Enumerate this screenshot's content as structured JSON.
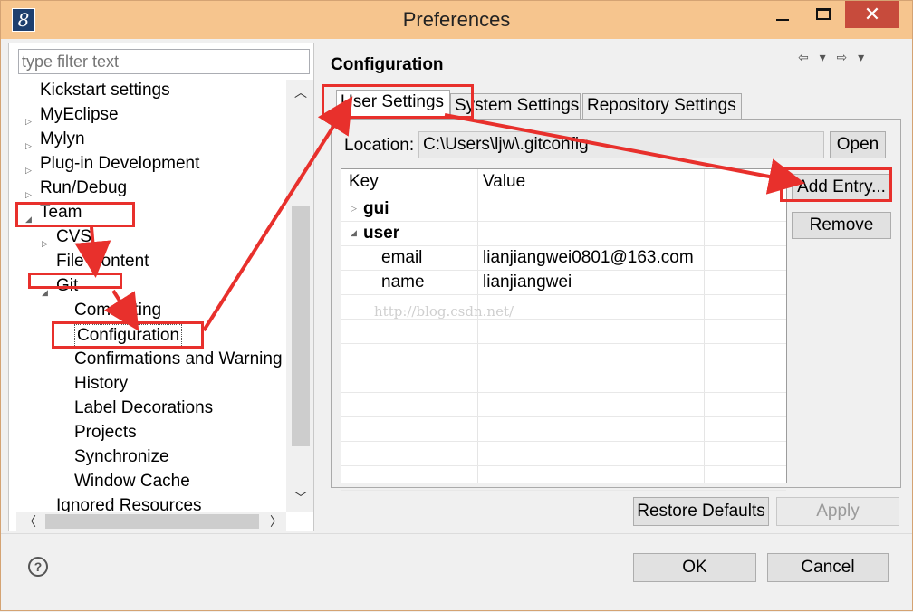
{
  "window": {
    "title": "Preferences",
    "app_icon_glyph": "8",
    "minimize_glyph": "",
    "close_glyph": "✕"
  },
  "left": {
    "filter_placeholder": "type filter text",
    "tree": [
      {
        "label": "Kickstart settings",
        "twisty": "",
        "level": 0
      },
      {
        "label": "MyEclipse",
        "twisty": "▷",
        "level": 0
      },
      {
        "label": "Mylyn",
        "twisty": "▷",
        "level": 0
      },
      {
        "label": "Plug-in Development",
        "twisty": "▷",
        "level": 0
      },
      {
        "label": "Run/Debug",
        "twisty": "▷",
        "level": 0
      },
      {
        "label": "Team",
        "twisty": "◢",
        "level": 0
      },
      {
        "label": "CVS",
        "twisty": "▷",
        "level": 1
      },
      {
        "label": "File Content",
        "twisty": "",
        "level": 1
      },
      {
        "label": "Git",
        "twisty": "◢",
        "level": 1
      },
      {
        "label": "Committing",
        "twisty": "",
        "level": 2
      },
      {
        "label": "Configuration",
        "twisty": "",
        "level": 2
      },
      {
        "label": "Confirmations and Warning",
        "twisty": "",
        "level": 2
      },
      {
        "label": "History",
        "twisty": "",
        "level": 2
      },
      {
        "label": "Label Decorations",
        "twisty": "",
        "level": 2
      },
      {
        "label": "Projects",
        "twisty": "",
        "level": 2
      },
      {
        "label": "Synchronize",
        "twisty": "",
        "level": 2
      },
      {
        "label": "Window Cache",
        "twisty": "",
        "level": 2
      },
      {
        "label": "Ignored Resources",
        "twisty": "",
        "level": 1
      }
    ]
  },
  "right": {
    "title": "Configuration",
    "nav_glyphs": "⇦ ▾ ⇨ ▾",
    "tabs": [
      "User Settings",
      "System Settings",
      "Repository Settings"
    ],
    "location_label": "Location:",
    "location_value": "C:\\Users\\ljw\\.gitconfig",
    "open_button": "Open",
    "columns": [
      "Key",
      "Value"
    ],
    "rows": [
      {
        "key": "gui",
        "value": "",
        "twisty": "▷",
        "bold": true
      },
      {
        "key": "user",
        "value": "",
        "twisty": "◢",
        "bold": true
      },
      {
        "key": "email",
        "value": "lianjiangwei0801@163.com",
        "twisty": "",
        "bold": false
      },
      {
        "key": "name",
        "value": "lianjiangwei",
        "twisty": "",
        "bold": false
      }
    ],
    "add_entry_button": "Add Entry...",
    "remove_button": "Remove",
    "watermark": "http://blog.csdn.net/",
    "restore_defaults_button": "Restore Defaults",
    "apply_button": "Apply"
  },
  "footer": {
    "help_glyph": "?",
    "ok_button": "OK",
    "cancel_button": "Cancel"
  },
  "colors": {
    "titlebar": "#f6c58e",
    "annotation_red": "#e8302c"
  }
}
